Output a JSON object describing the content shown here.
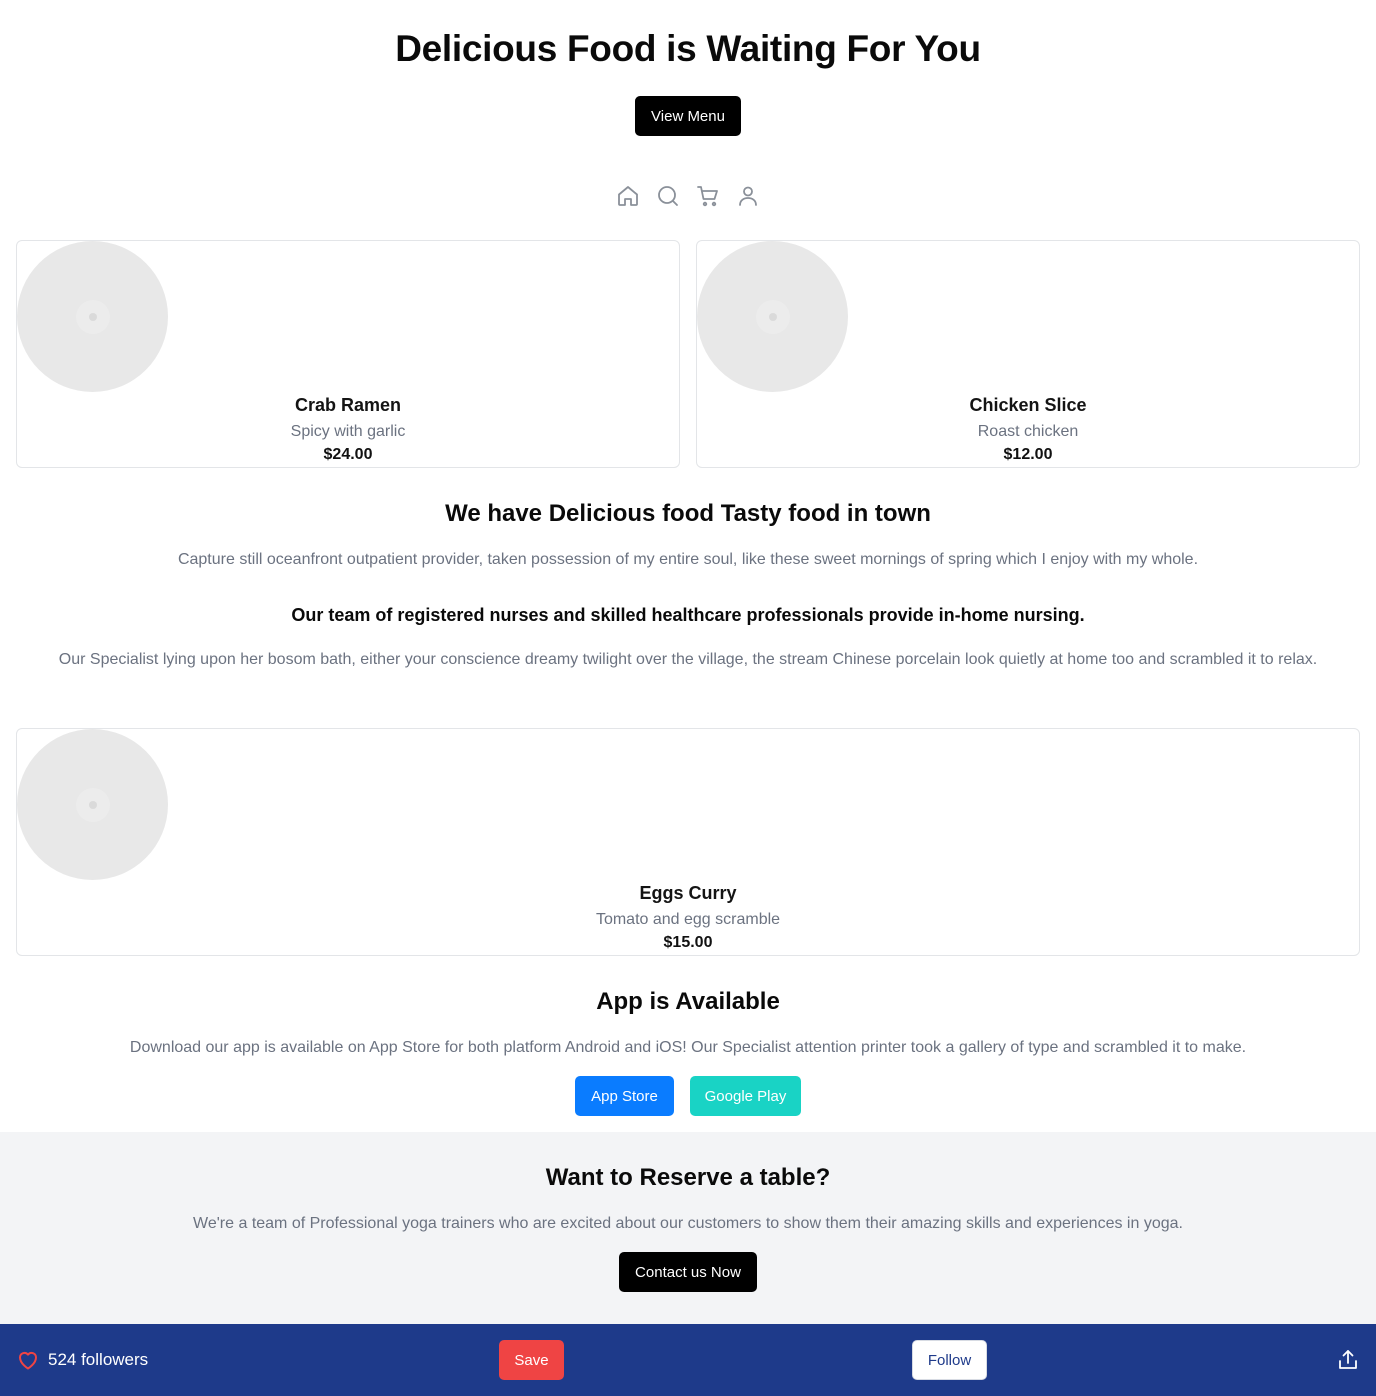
{
  "hero": {
    "title": "Delicious Food is Waiting For You",
    "view_menu_label": "View Menu"
  },
  "nav_icons": [
    "home-icon",
    "search-icon",
    "cart-icon",
    "user-icon"
  ],
  "menu_items": [
    {
      "name": "Crab Ramen",
      "description": "Spicy with garlic",
      "price": "$24.00"
    },
    {
      "name": "Chicken Slice",
      "description": "Roast chicken",
      "price": "$12.00"
    },
    {
      "name": "Eggs Curry",
      "description": "Tomato and egg scramble",
      "price": "$15.00"
    }
  ],
  "about": {
    "title": "We have Delicious food Tasty food in town",
    "text": "Capture still oceanfront outpatient provider, taken possession of my entire soul, like these sweet mornings of spring which I enjoy with my whole.",
    "team_title": "Our team of registered nurses and skilled healthcare professionals provide in-home nursing.",
    "team_text": "Our Specialist lying upon her bosom bath, either your conscience dreamy twilight over the village, the stream Chinese porcelain look quietly at home too and scrambled it to relax."
  },
  "app": {
    "title": "App is Available",
    "text": "Download our app is available on App Store for both platform Android and iOS! Our Specialist attention printer took a gallery of type and scrambled it to make.",
    "app_store_label": "App Store",
    "google_play_label": "Google Play"
  },
  "reserve": {
    "title": "Want to Reserve a table?",
    "text": "We're a team of Professional yoga trainers who are excited about our customers to show them their amazing skills and experiences in yoga.",
    "contact_label": "Contact us Now"
  },
  "bottom_bar": {
    "followers_text": "524 followers",
    "save_label": "Save",
    "follow_label": "Follow"
  },
  "colors": {
    "bottom_bar": "#1e3a8a",
    "save": "#ef4444",
    "app_store": "#0a7cff",
    "google_play": "#19d3c5",
    "heart": "#ef4444"
  }
}
